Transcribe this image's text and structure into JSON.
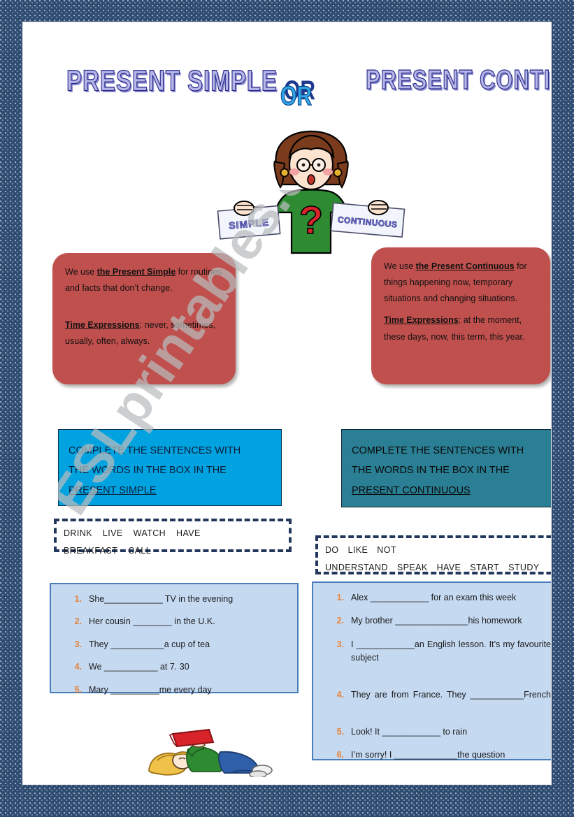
{
  "title": {
    "left": "PRESENT SIMPLE",
    "connector": "OR",
    "right": "PRESENT CONTINUOUS"
  },
  "illustration_top": {
    "name": "woman-holding-signs",
    "sign_left": "SIMPLE",
    "sign_right": "CONTINUOUS",
    "shirt_symbol": "?"
  },
  "rules": {
    "simple": {
      "line1_pre": "We use ",
      "line1_bold": "the Present Simple",
      "line1_post": " for routines and facts that don’t change.",
      "time_label": "Time Expressions",
      "time_text": ": never, sometimes, usually, often, always."
    },
    "continuous": {
      "line1_pre": "We use ",
      "line1_bold": "the Present Continuous",
      "line1_post": " for things happening now, temporary situations and changing situations.",
      "time_label": "Time Expressions",
      "time_text": ": at the moment, these days, now, this term, this year."
    }
  },
  "instructions": {
    "simple": {
      "line1": "COMPLETE THE SENTENCES WITH",
      "line2": "THE WORDS IN THE BOX IN THE",
      "tense": "PRESENT  SIMPLE"
    },
    "continuous": {
      "line1": "COMPLETE THE SENTENCES WITH",
      "line2": "THE WORDS IN THE BOX IN THE",
      "tense": "PRESENT  CONTINUOUS"
    }
  },
  "word_banks": {
    "simple": [
      "DRINK",
      "LIVE",
      "WATCH",
      "HAVE BREAKFAST",
      "CALL"
    ],
    "continuous": [
      "DO",
      "LIKE",
      "NOT UNDERSTAND",
      "SPEAK",
      "HAVE",
      "START",
      "STUDY"
    ]
  },
  "exercises": {
    "simple": [
      {
        "number": "1.",
        "text": "She____________ TV in the evening"
      },
      {
        "number": "2.",
        "text": "Her cousin ________ in the U.K."
      },
      {
        "number": "3.",
        "text": "They ___________a cup of tea"
      },
      {
        "number": "4.",
        "text": "We ___________ at 7. 30"
      },
      {
        "number": "5.",
        "text": "Mary __________me every day"
      }
    ],
    "continuous": [
      {
        "number": "1.",
        "text": "Alex ____________ for an exam this week"
      },
      {
        "number": "2.",
        "text": "My brother _______________his homework"
      },
      {
        "number": "3.",
        "text": "I ____________an English lesson. It’s my favourite subject"
      },
      {
        "number": "4.",
        "text": "They are from France. They ___________French"
      },
      {
        "number": "5.",
        "text": "Look! It  ____________ to rain"
      },
      {
        "number": "6.",
        "text": "I’m sorry! I _____________the  question"
      }
    ]
  },
  "illustration_bottom": {
    "name": "person-reading-book"
  },
  "watermark": {
    "text": "ESLprintables.com"
  },
  "colors": {
    "border_navy": "#2e4c72",
    "rule_red": "#c0504d",
    "instruction_blue": "#00a3e0",
    "instruction_teal": "#2a7f94",
    "exercise_fill": "#c5d9f1",
    "exercise_border": "#4a7ebb",
    "number_orange": "#e8833a",
    "title_lavender": "#b6b7e8",
    "title_outline": "#2d2d8c",
    "or_cyan": "#2ea8e8"
  }
}
